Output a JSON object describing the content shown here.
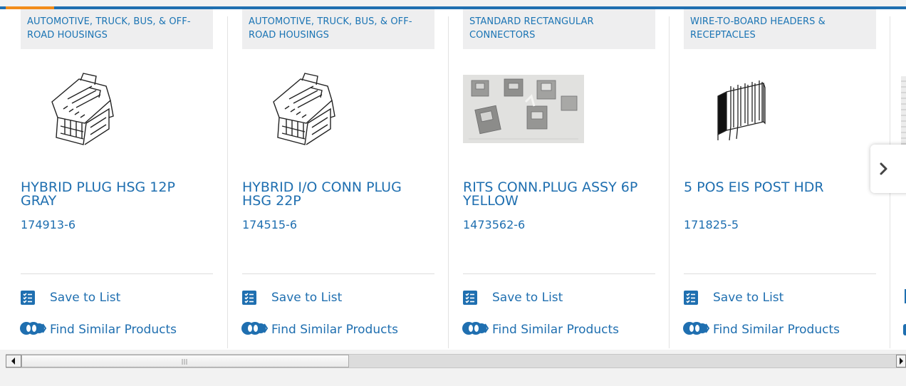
{
  "colors": {
    "accent": "#1f6fb0",
    "accent_orange": "#f28c1a",
    "tag_bg": "#eeeeef"
  },
  "cards": [
    {
      "category": "AUTOMOTIVE, TRUCK, BUS, & OFF-ROAD HOUSINGS",
      "title": "HYBRID PLUG HSG 12P GRAY",
      "part_number": "174913-6",
      "image_icon": "connector-housing-drawing",
      "save_label": "Save to List",
      "similar_label": "Find Similar Products"
    },
    {
      "category": "AUTOMOTIVE, TRUCK, BUS, & OFF-ROAD HOUSINGS",
      "title": "HYBRID I/O CONN PLUG HSG 22P",
      "part_number": "174515-6",
      "image_icon": "connector-housing-drawing",
      "save_label": "Save to List",
      "similar_label": "Find Similar Products"
    },
    {
      "category": "STANDARD RECTANGULAR CONNECTORS",
      "title": "RITS CONN.PLUG ASSY 6P YELLOW",
      "part_number": "1473562-6",
      "image_icon": "connector-photo",
      "save_label": "Save to List",
      "similar_label": "Find Similar Products"
    },
    {
      "category": "WIRE-TO-BOARD HEADERS & RECEPTACLES",
      "title": "5 POS EIS POST HDR",
      "part_number": "171825-5",
      "image_icon": "pin-header-drawing",
      "save_label": "Save to List",
      "similar_label": "Find Similar Products"
    }
  ],
  "next_icon": "chevron-right-icon"
}
